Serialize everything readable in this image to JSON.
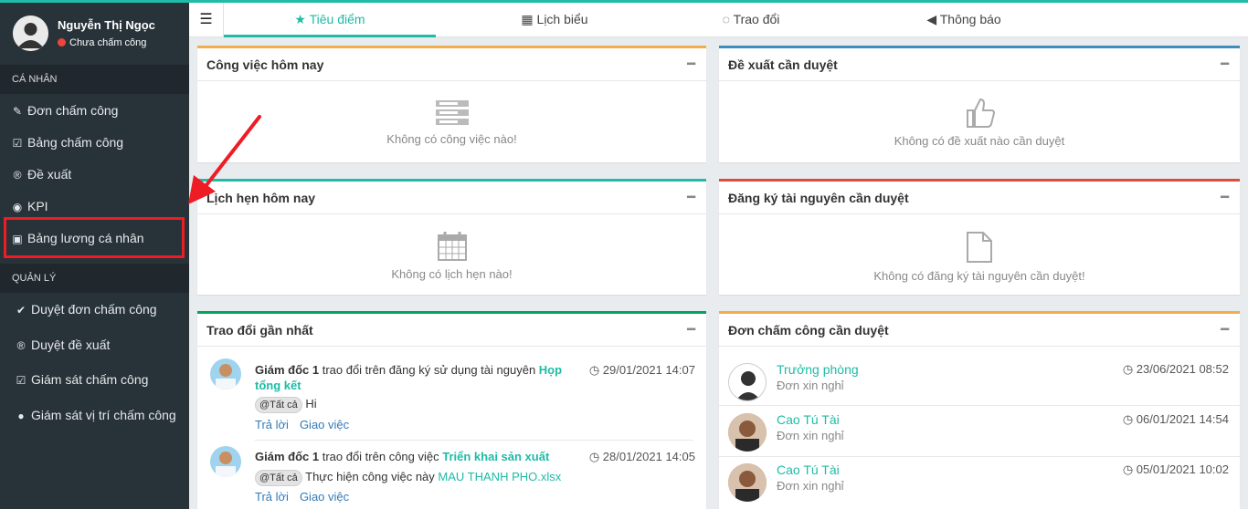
{
  "user": {
    "name": "Nguyễn Thị Ngọc",
    "status": "Chưa chấm công"
  },
  "sidebar": {
    "personal_section": "CÁ NHÂN",
    "personal_items": [
      {
        "label": "Đơn chấm công",
        "icon": "edit-icon"
      },
      {
        "label": "Bảng chấm công",
        "icon": "calendar-check-icon"
      },
      {
        "label": "Đề xuất",
        "icon": "registered-icon"
      },
      {
        "label": "KPI",
        "icon": "eye-icon"
      },
      {
        "label": "Bảng lương cá nhân",
        "icon": "money-icon"
      }
    ],
    "manage_section": "QUẢN LÝ",
    "manage_items": [
      {
        "label": "Duyệt đơn chấm công",
        "icon": "check-circle-icon"
      },
      {
        "label": "Duyệt đề xuất",
        "icon": "registered-icon"
      },
      {
        "label": "Giám sát chấm công",
        "icon": "calendar-check-icon"
      },
      {
        "label": "Giám sát vị trí chấm công",
        "icon": "map-marker-icon"
      }
    ]
  },
  "tabs": [
    {
      "label": "Tiêu điểm",
      "icon": "star-icon",
      "active": true
    },
    {
      "label": "Lịch biểu",
      "icon": "calendar-icon",
      "active": false
    },
    {
      "label": "Trao đổi",
      "icon": "comment-icon",
      "active": false
    },
    {
      "label": "Thông báo",
      "icon": "bullhorn-icon",
      "active": false
    }
  ],
  "panels": {
    "tasks": {
      "title": "Công việc hôm nay",
      "empty": "Không có công việc nào!"
    },
    "proposals": {
      "title": "Đề xuất cần duyệt",
      "empty": "Không có đề xuất nào cần duyệt"
    },
    "appointments": {
      "title": "Lịch hẹn hôm nay",
      "empty": "Không có lịch hẹn nào!"
    },
    "resources": {
      "title": "Đăng ký tài nguyên cần duyệt",
      "empty": "Không có đăng ký tài nguyên cần duyệt!"
    },
    "discussions": {
      "title": "Trao đổi gần nhất",
      "items": [
        {
          "author": "Giám đốc 1",
          "action": "trao đổi trên đăng ký sử dụng tài nguyên",
          "target": "Họp tổng kết",
          "time": "29/01/2021 14:07",
          "mention": "@Tất cả",
          "message": "Hi",
          "message_link": "",
          "reply": "Trả lời",
          "assign": "Giao việc"
        },
        {
          "author": "Giám đốc 1",
          "action": "trao đổi trên công việc",
          "target": "Triển khai sản xuất",
          "time": "28/01/2021 14:05",
          "mention": "@Tất cả",
          "message": "Thực hiện công việc này",
          "message_link": "MAU THANH PHO.xlsx",
          "reply": "Trả lời",
          "assign": "Giao việc"
        }
      ]
    },
    "attendance": {
      "title": "Đơn chấm công cần duyệt",
      "items": [
        {
          "name": "Trưởng phòng",
          "type": "Đơn xin nghỉ",
          "time": "23/06/2021 08:52"
        },
        {
          "name": "Cao Tú Tài",
          "type": "Đơn xin nghỉ",
          "time": "06/01/2021 14:54"
        },
        {
          "name": "Cao Tú Tài",
          "type": "Đơn xin nghỉ",
          "time": "05/01/2021 10:02"
        }
      ]
    }
  },
  "colors": {
    "accent": "#1fbba6",
    "sidebar": "#283239",
    "highlight": "#ee1c25",
    "warning": "#f0ad4e",
    "info": "#3c8dbc",
    "danger": "#dd4b39",
    "success": "#00a65a"
  }
}
